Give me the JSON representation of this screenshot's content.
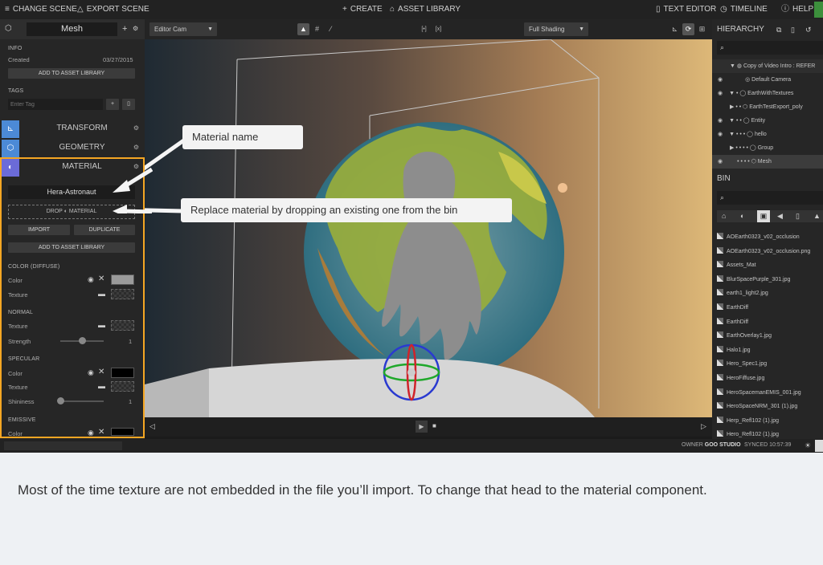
{
  "topbar": {
    "change_scene": "CHANGE SCENE",
    "export_scene": "EXPORT SCENE",
    "create": "CREATE",
    "asset_library": "ASSET LIBRARY",
    "text_editor": "TEXT EDITOR",
    "timeline": "TIMELINE",
    "help": "HELP"
  },
  "viewport_toolbar": {
    "camera": "Editor Cam",
    "grid_icon": "#",
    "bracket_left": "[•]",
    "bracket_right": "[x]",
    "shading": "Full Shading"
  },
  "inspector": {
    "title": "Mesh",
    "info_header": "INFO",
    "created_label": "Created",
    "created_date": "03/27/2015",
    "add_to_asset_library": "ADD TO ASSET LIBRARY",
    "tags_header": "TAGS",
    "tag_placeholder": "Enter Tag",
    "sections": {
      "transform": "TRANSFORM",
      "geometry": "GEOMETRY",
      "material": "MATERIAL"
    },
    "material": {
      "name": "Hera-Astronaut",
      "drop_label": "DROP",
      "drop_label2": "MATERIAL",
      "import": "IMPORT",
      "duplicate": "DUPLICATE",
      "add_to_asset_library": "ADD TO ASSET LIBRARY",
      "color_diffuse": "COLOR (DIFFUSE)",
      "color_label": "Color",
      "texture_label": "Texture",
      "normal": "NORMAL",
      "normal_texture_label": "Texture",
      "strength_label": "Strength",
      "strength_value": "1",
      "specular": "SPECULAR",
      "spec_color_label": "Color",
      "spec_texture_label": "Texture",
      "shininess_label": "Shininess",
      "shininess_value": "1",
      "emissive": "EMISSIVE",
      "emissive_color_label": "Color"
    }
  },
  "hierarchy": {
    "title": "HIERARCHY",
    "items": [
      "Copy of Video Intro : REFER",
      "Default Camera",
      "EarthWithTextures",
      "EarthTestExport_poly",
      "Entity",
      "hello",
      "Group",
      "Mesh"
    ]
  },
  "bin": {
    "title": "BIN",
    "items": [
      "AOEarth0323_v02_occlusion",
      "AOEarth0323_v02_occlusion.png",
      "Assets_Mat",
      "BlurSpacePurple_301.jpg",
      "earth1_light2.jpg",
      "EarthDiff",
      "EarthDiff",
      "EarthOverlay1.jpg",
      "Halo1.jpg",
      "Hero_Spec1.jpg",
      "HeroFiffuse.jpg",
      "HeroSpacemanEMIS_001.jpg",
      "HeroSpaceNRM_301 (1).jpg",
      "Herp_Refl102 (1).jpg",
      "Hero_Refl102 (1).jpg"
    ]
  },
  "statusbar": {
    "owner_label": "OWNER",
    "owner_name": "GOO STUDIO",
    "synced": "SYNCED 10:57:39"
  },
  "callouts": {
    "material_name": "Material name",
    "replace_material": "Replace material by dropping an existing one from the bin"
  },
  "caption": "Most of the time texture are not embedded in the file you’ll import. To change that head to the material component.",
  "colors": {
    "accent_blue": "#4c8ad6",
    "highlight_orange": "#f5a623"
  }
}
